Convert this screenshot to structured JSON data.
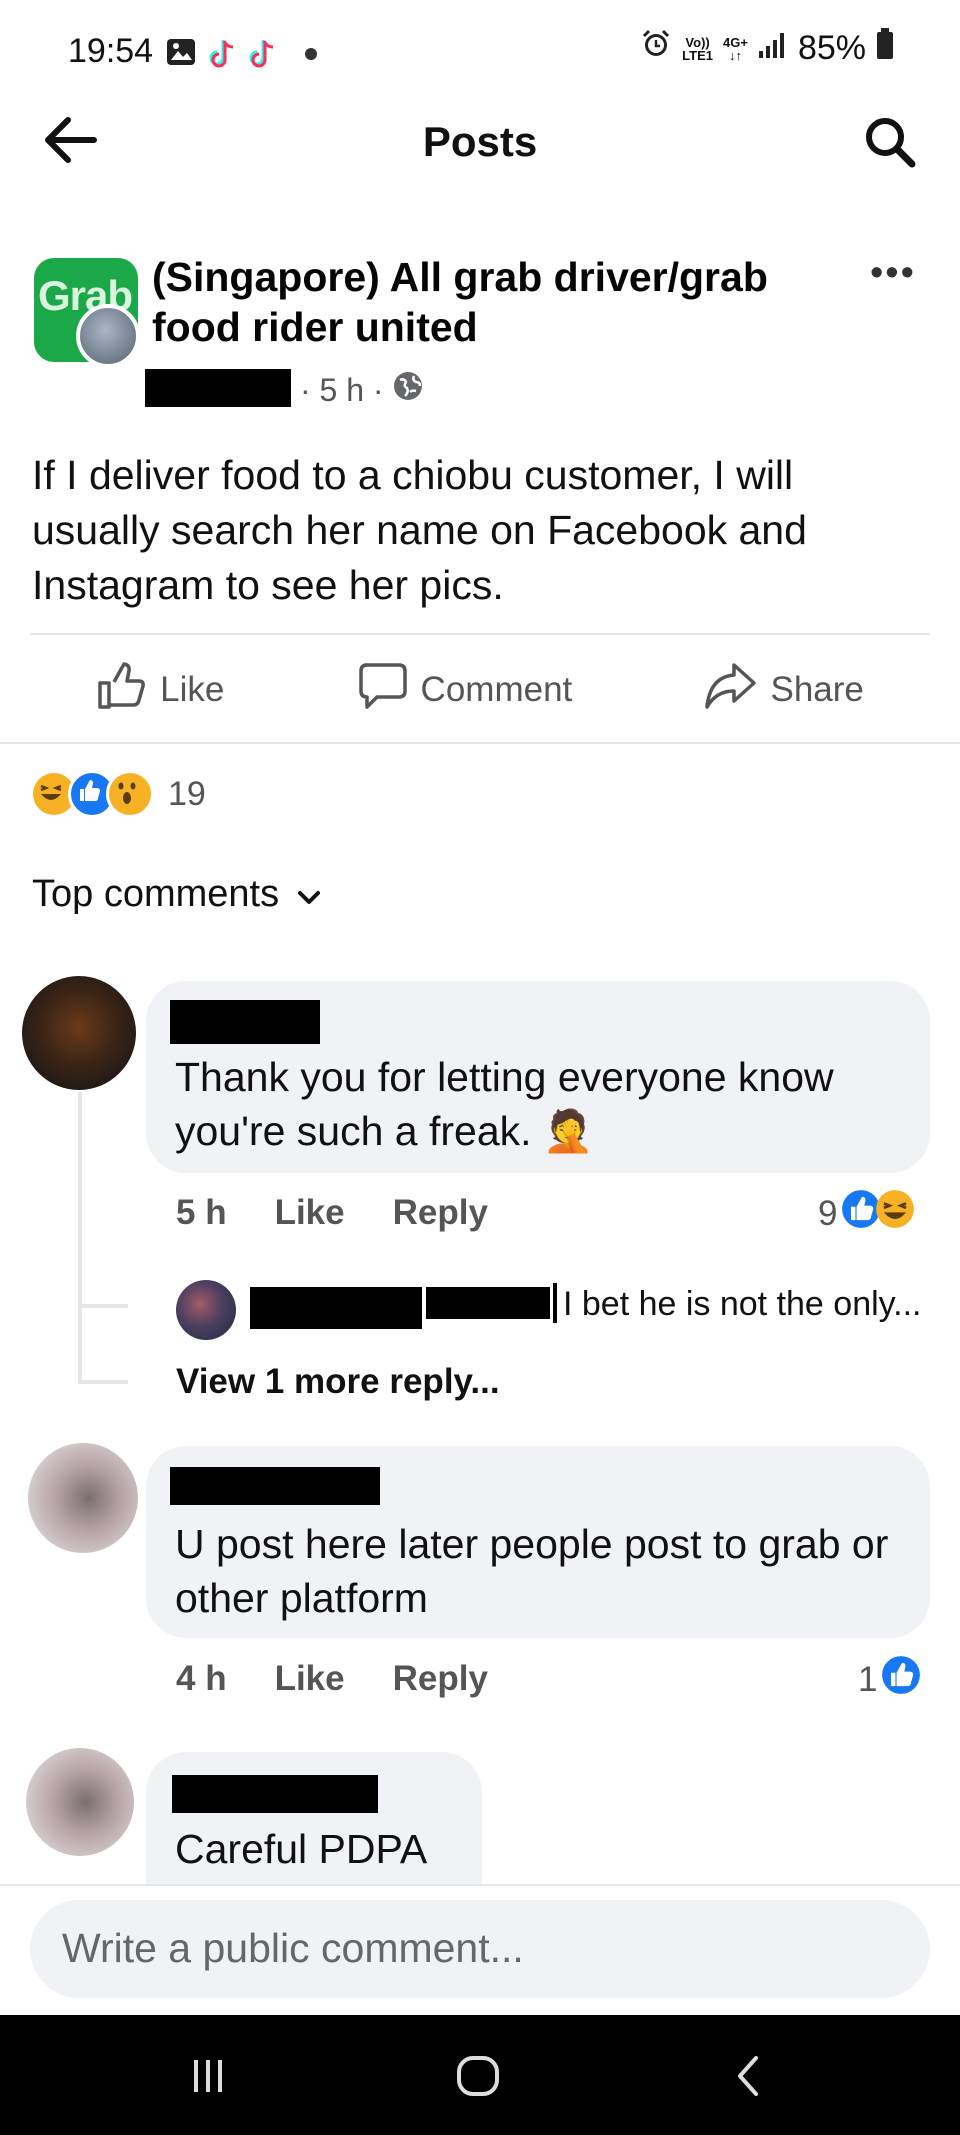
{
  "status_bar": {
    "time": "19:54",
    "network_top": "Vo))",
    "network_bottom": "LTE1",
    "network_gen": "4G+",
    "battery": "85%"
  },
  "top_bar": {
    "title": "Posts"
  },
  "post": {
    "group_logo_text": "Grab",
    "group_name": "(Singapore) All grab driver/grab food rider united",
    "meta": "· 5 h ·",
    "body": "If I deliver food to a chiobu customer, I will usually search her name on Facebook and Instagram to see her pics.",
    "actions": {
      "like": "Like",
      "comment": "Comment",
      "share": "Share"
    },
    "reaction_count": "19"
  },
  "comments_header": {
    "sort_label": "Top comments"
  },
  "comments": [
    {
      "text": "Thank you for letting everyone know you're such a freak. 🤦",
      "time": "5 h",
      "like": "Like",
      "reply": "Reply",
      "reaction_count": "9",
      "reply_preview": "I bet he is not the only...",
      "view_more": "View 1 more reply..."
    },
    {
      "text": "U post here later people post to grab or other platform",
      "time": "4 h",
      "like": "Like",
      "reply": "Reply",
      "reaction_count": "1"
    },
    {
      "text": "Careful PDPA"
    }
  ],
  "composer": {
    "placeholder": "Write a public comment..."
  },
  "colors": {
    "fb_blue": "#1877f2",
    "grab_green": "#1aa849",
    "bubble": "#f0f2f5"
  }
}
